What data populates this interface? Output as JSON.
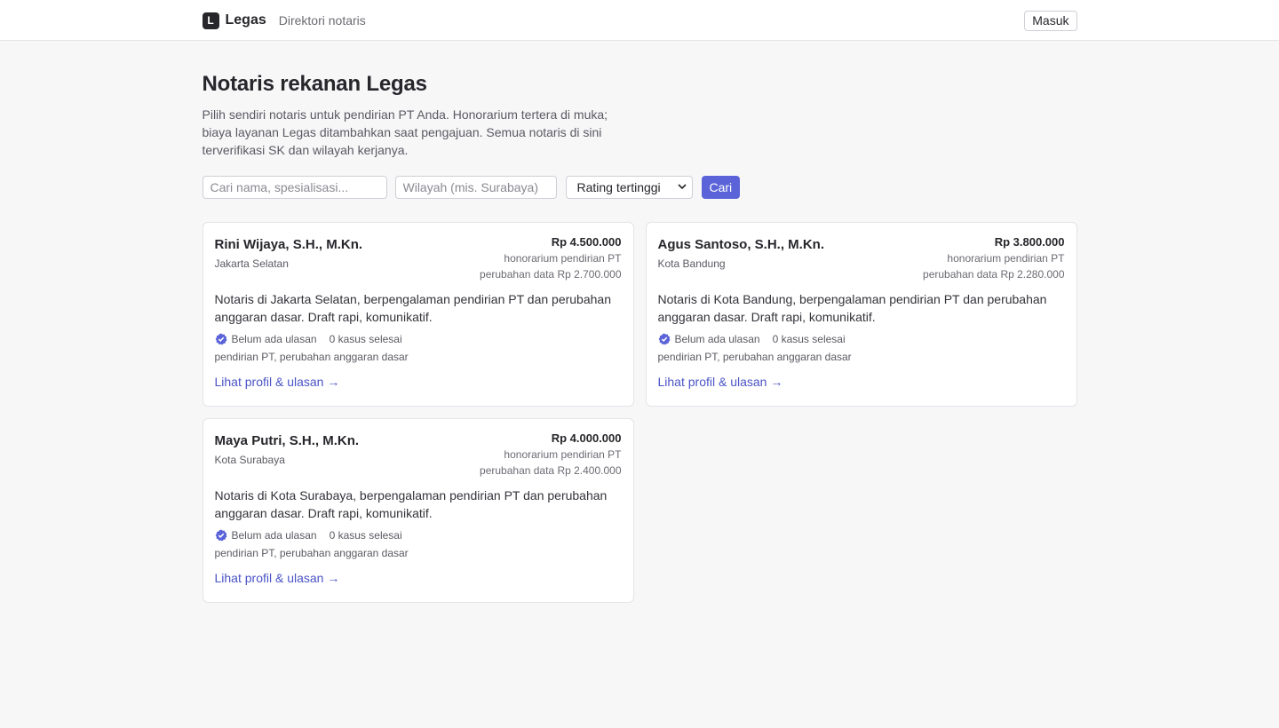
{
  "header": {
    "logo_letter": "L",
    "brand": "Legas",
    "subtitle": "Direktori notaris",
    "login_label": "Masuk"
  },
  "page": {
    "title": "Notaris rekanan Legas",
    "description": "Pilih sendiri notaris untuk pendirian PT Anda. Honorarium tertera di muka; biaya layanan Legas ditambahkan saat pengajuan. Semua notaris di sini terverifikasi SK dan wilayah kerjanya."
  },
  "filters": {
    "search_placeholder": "Cari nama, spesialisasi...",
    "region_placeholder": "Wilayah (mis. Surabaya)",
    "sort_value": "Rating tertinggi",
    "search_button": "Cari"
  },
  "notaries": [
    {
      "name": "Rini Wijaya, S.H., M.Kn.",
      "location": "Jakarta Selatan",
      "price": "Rp 4.500.000",
      "price_label": "honorarium pendirian PT",
      "change_price": "perubahan data Rp 2.700.000",
      "description": "Notaris di Jakarta Selatan, berpengalaman pendirian PT dan perubahan anggaran dasar. Draft rapi, komunikatif.",
      "reviews": "Belum ada ulasan",
      "cases": "0 kasus selesai",
      "specialties": "pendirian PT, perubahan anggaran dasar",
      "link": "Lihat profil & ulasan →"
    },
    {
      "name": "Agus Santoso, S.H., M.Kn.",
      "location": "Kota Bandung",
      "price": "Rp 3.800.000",
      "price_label": "honorarium pendirian PT",
      "change_price": "perubahan data Rp 2.280.000",
      "description": "Notaris di Kota Bandung, berpengalaman pendirian PT dan perubahan anggaran dasar. Draft rapi, komunikatif.",
      "reviews": "Belum ada ulasan",
      "cases": "0 kasus selesai",
      "specialties": "pendirian PT, perubahan anggaran dasar",
      "link": "Lihat profil & ulasan →"
    },
    {
      "name": "Maya Putri, S.H., M.Kn.",
      "location": "Kota Surabaya",
      "price": "Rp 4.000.000",
      "price_label": "honorarium pendirian PT",
      "change_price": "perubahan data Rp 2.400.000",
      "description": "Notaris di Kota Surabaya, berpengalaman pendirian PT dan perubahan anggaran dasar. Draft rapi, komunikatif.",
      "reviews": "Belum ada ulasan",
      "cases": "0 kasus selesai",
      "specialties": "pendirian PT, perubahan anggaran dasar",
      "link": "Lihat profil & ulasan →"
    }
  ],
  "icons": {
    "verified": "verified-badge-icon",
    "sort_chevron": "chevron-down-icon"
  },
  "colors": {
    "accent": "#5a63d8",
    "link": "#4a53c6",
    "background": "#f7f7f8"
  }
}
